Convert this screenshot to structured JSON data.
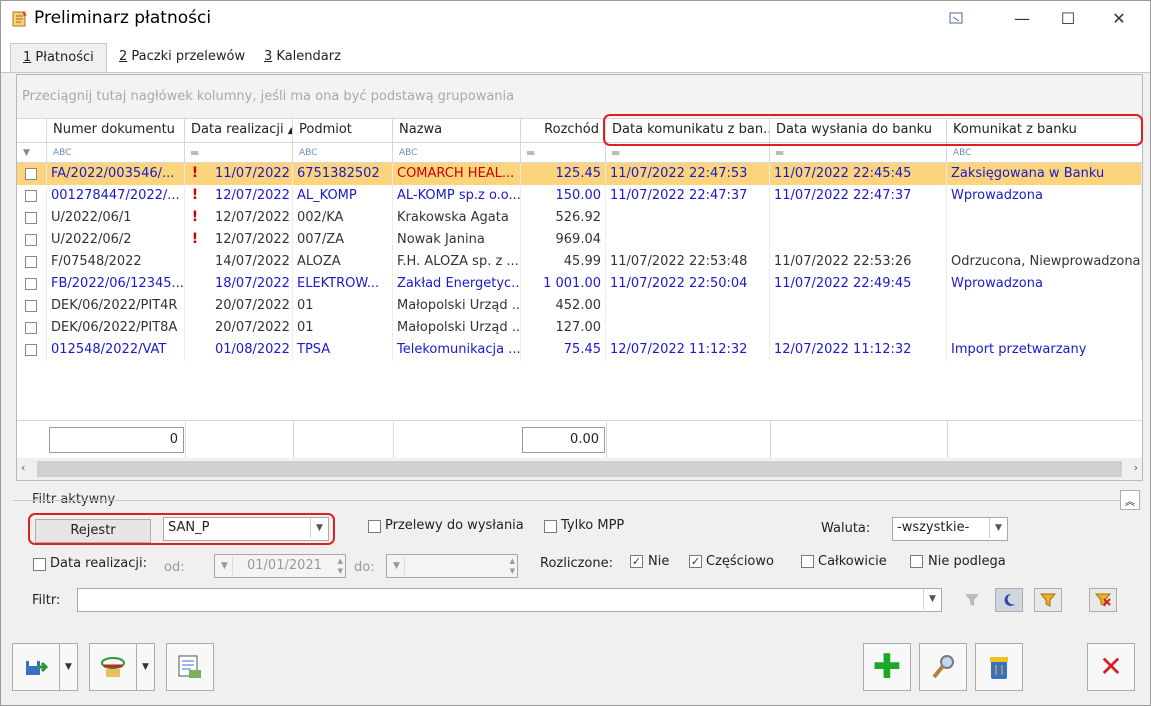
{
  "window": {
    "title": "Preliminarz płatności"
  },
  "tabs": [
    {
      "key": "1",
      "label": " Płatności"
    },
    {
      "key": "2",
      "label": " Paczki przelewów"
    },
    {
      "key": "3",
      "label": " Kalendarz"
    }
  ],
  "grid": {
    "group_hint": "Przeciągnij tutaj nagłówek kolumny, jeśli ma ona być podstawą grupowania",
    "columns": [
      "Numer dokumentu",
      "Data realizacji",
      "Podmiot",
      "Nazwa",
      "Rozchód",
      "Data komunikatu z ban...",
      "Data wysłania do banku",
      "Komunikat z banku"
    ],
    "rows": [
      {
        "numer": "FA/2022/003546/...",
        "alert": "!",
        "data": "11/07/2022",
        "podmiot": "6751382502",
        "nazwa": "COMARCH HEAL...",
        "rozchod": "125.45",
        "data_kom": "11/07/2022 22:47:53",
        "data_wys": "11/07/2022 22:45:45",
        "komunikat": "Zaksięgowana w Banku"
      },
      {
        "numer": "001278447/2022/...",
        "alert": "!",
        "data": "12/07/2022",
        "podmiot": "AL_KOMP",
        "nazwa": "AL-KOMP sp.z o.o....",
        "rozchod": "150.00",
        "data_kom": "11/07/2022 22:47:37",
        "data_wys": "11/07/2022 22:47:37",
        "komunikat": "Wprowadzona"
      },
      {
        "numer": "U/2022/06/1",
        "alert": "!",
        "data": "12/07/2022",
        "podmiot": "002/KA",
        "nazwa": "Krakowska Agata",
        "rozchod": "526.92",
        "data_kom": "",
        "data_wys": "",
        "komunikat": ""
      },
      {
        "numer": "U/2022/06/2",
        "alert": "!",
        "data": "12/07/2022",
        "podmiot": "007/ZA",
        "nazwa": "Nowak Janina",
        "rozchod": "969.04",
        "data_kom": "",
        "data_wys": "",
        "komunikat": ""
      },
      {
        "numer": "F/07548/2022",
        "alert": "",
        "data": "14/07/2022",
        "podmiot": "ALOZA",
        "nazwa": "F.H. ALOZA sp. z ...",
        "rozchod": "45.99",
        "data_kom": "11/07/2022 22:53:48",
        "data_wys": "11/07/2022 22:53:26",
        "komunikat": "Odrzucona, Niewprowadzona"
      },
      {
        "numer": "FB/2022/06/12345...",
        "alert": "",
        "data": "18/07/2022",
        "podmiot": "ELEKTROW...",
        "nazwa": "Zakład Energetyc...",
        "rozchod": "1 001.00",
        "data_kom": "11/07/2022 22:50:04",
        "data_wys": "11/07/2022 22:49:45",
        "komunikat": "Wprowadzona"
      },
      {
        "numer": "DEK/06/2022/PIT4R",
        "alert": "",
        "data": "20/07/2022",
        "podmiot": "01",
        "nazwa": "Małopolski Urząd ...",
        "rozchod": "452.00",
        "data_kom": "",
        "data_wys": "",
        "komunikat": ""
      },
      {
        "numer": "DEK/06/2022/PIT8A",
        "alert": "",
        "data": "20/07/2022",
        "podmiot": "01",
        "nazwa": "Małopolski Urząd ...",
        "rozchod": "127.00",
        "data_kom": "",
        "data_wys": "",
        "komunikat": ""
      },
      {
        "numer": "012548/2022/VAT",
        "alert": "",
        "data": "01/08/2022",
        "podmiot": "TPSA",
        "nazwa": "Telekomunikacja ...",
        "rozchod": "75.45",
        "data_kom": "12/07/2022 11:12:32",
        "data_wys": "12/07/2022 11:12:32",
        "komunikat": "Import przetwarzany"
      }
    ],
    "footer": {
      "count": "0",
      "sum": "0.00"
    }
  },
  "filter": {
    "title": "Filtr aktywny",
    "rejestr_button": "Rejestr",
    "rejestr_value": "SAN_P",
    "przelewy_label": "Przelewy do wysłania",
    "tylko_mpp_label": "Tylko MPP",
    "waluta_label": "Waluta:",
    "waluta_value": "-wszystkie-",
    "data_realizacji_label": "Data realizacji:",
    "od_label": "od:",
    "od_value": "01/01/2021",
    "do_label": "do:",
    "do_value": "",
    "rozliczone_label": "Rozliczone:",
    "nie_label": "Nie",
    "czesciowo_label": "Częściowo",
    "calkowicie_label": "Całkowicie",
    "nie_podlega_label": "Nie podlega",
    "filtr_label": "Filtr:",
    "filtr_value": ""
  },
  "colors": {
    "selected_row": "#fcd47c",
    "link_blue": "#1a1acc",
    "highlight_red": "#e02020"
  }
}
